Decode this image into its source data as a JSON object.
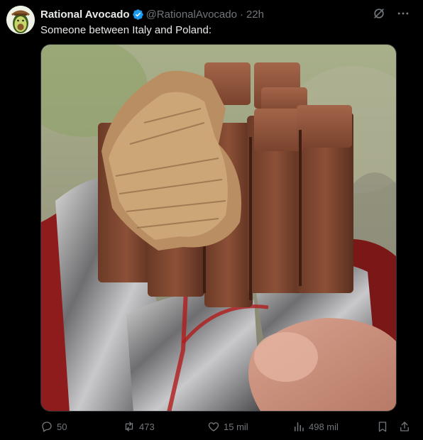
{
  "tweet": {
    "author_name": "Rational Avocado",
    "handle": "@RationalAvocado",
    "separator": "·",
    "time": "22h",
    "text": "Someone between Italy and Poland:",
    "verified": true
  },
  "stats": {
    "replies": "50",
    "retweets": "473",
    "likes": "15 mil",
    "views": "498 mil"
  },
  "icons": {
    "avatar": "avocado-avatar",
    "verified": "verified-badge-icon",
    "grok": "grok-icon",
    "more": "more-icon",
    "reply": "reply-icon",
    "retweet": "retweet-icon",
    "like": "heart-icon",
    "views": "views-icon",
    "bookmark": "bookmark-icon",
    "share": "share-icon"
  },
  "colors": {
    "background": "#000000",
    "text_primary": "#e7e9ea",
    "text_secondary": "#71767b",
    "verified_blue": "#1d9bf0"
  }
}
